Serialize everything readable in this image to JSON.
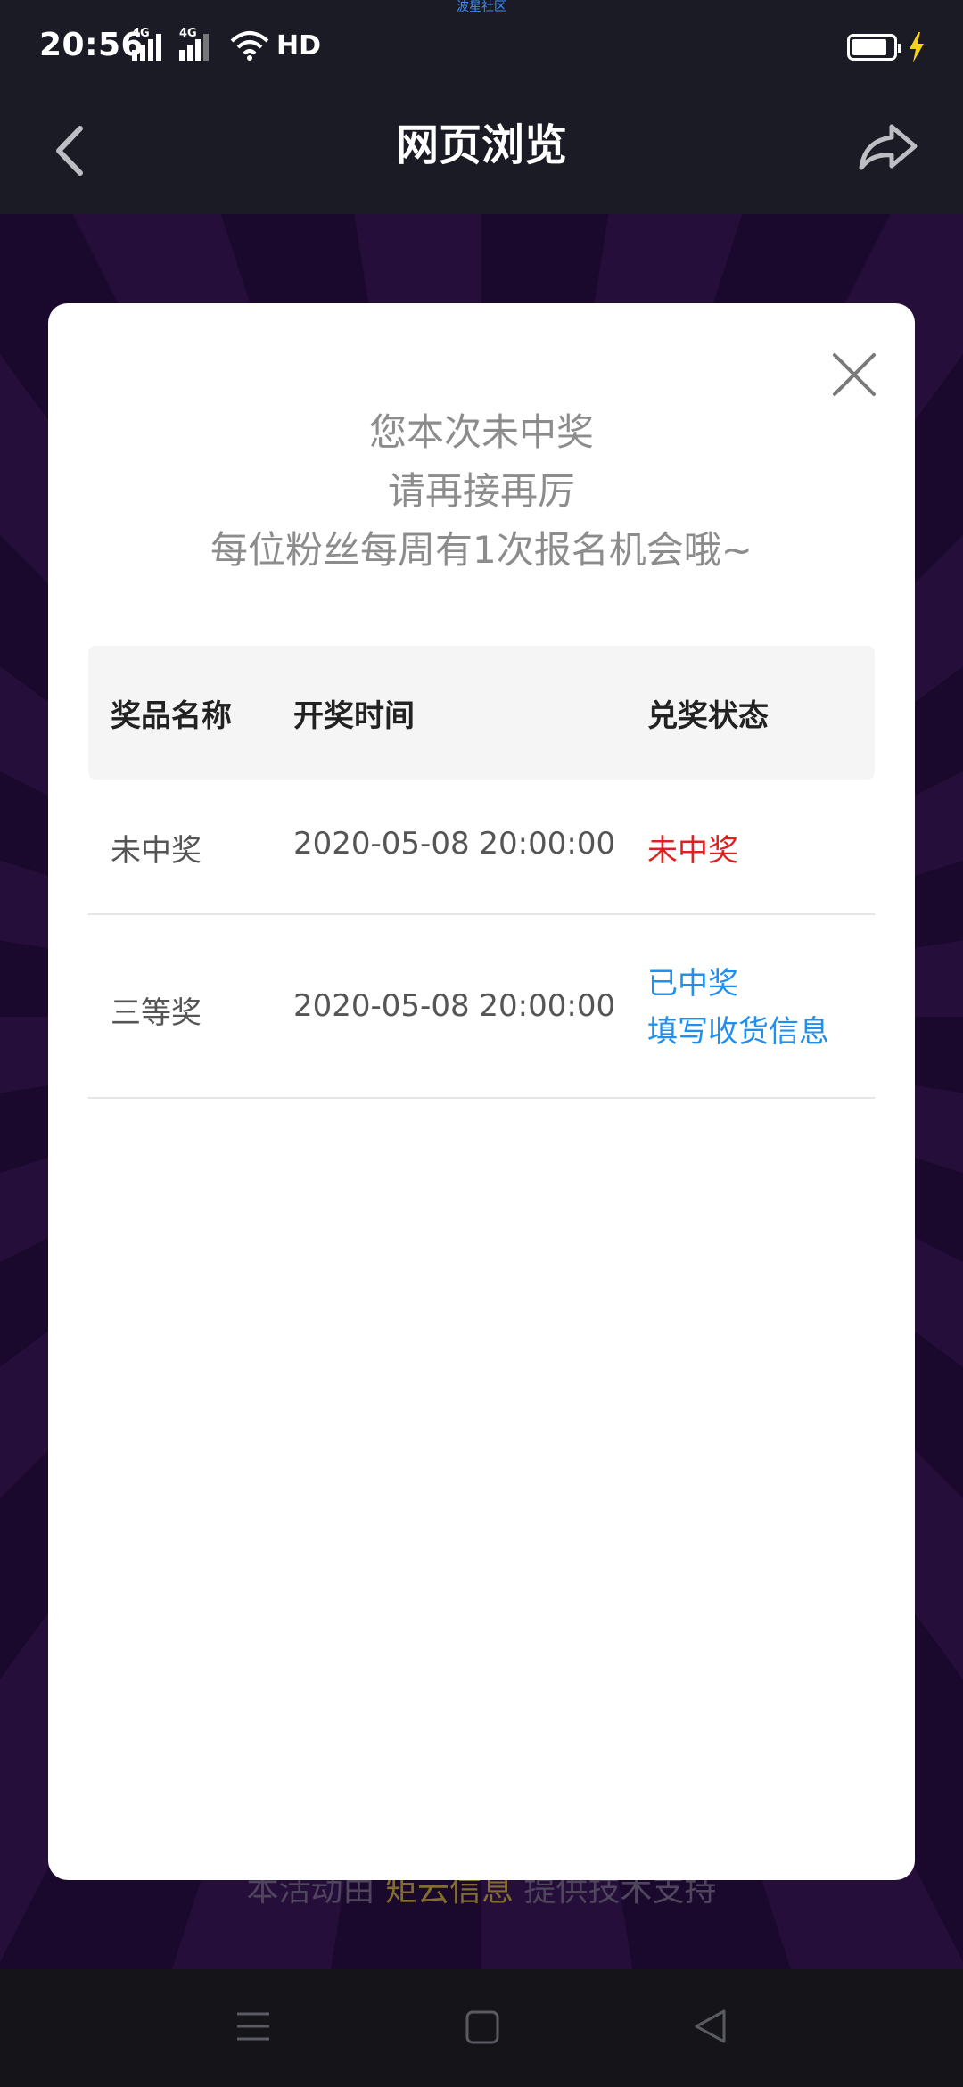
{
  "status_bar": {
    "watermark": "波星社区",
    "time": "20:56",
    "network1": "4G",
    "network2": "4G",
    "hd": "HD",
    "icons": [
      "signal-icon",
      "signal-icon",
      "wifi-icon",
      "battery-icon",
      "charging-icon"
    ]
  },
  "nav": {
    "title": "网页浏览",
    "back_icon": "chevron-left-icon",
    "share_icon": "share-icon"
  },
  "background": {
    "footer_prefix": "本活动由",
    "footer_brand": "矩云信息",
    "footer_suffix": "提供技术支持"
  },
  "modal": {
    "close_icon": "close-icon",
    "message_line1": "您本次未中奖",
    "message_line2": "请再接再厉",
    "message_line3": "每位粉丝每周有1次报名机会哦~",
    "table": {
      "headers": [
        "奖品名称",
        "开奖时间",
        "兑奖状态"
      ],
      "rows": [
        {
          "prize": "未中奖",
          "time": "2020-05-08 20:00:00",
          "status": "未中奖"
        },
        {
          "prize": "三等奖",
          "time": "2020-05-08 20:00:00",
          "status": "已中奖",
          "action": "填写收货信息"
        }
      ]
    }
  },
  "colors": {
    "lost": "#e02020",
    "won": "#1f8ff0",
    "header_bg": "#1b1b25"
  },
  "system_nav": {
    "icons": [
      "menu-icon",
      "home-icon",
      "back-triangle-icon"
    ]
  }
}
